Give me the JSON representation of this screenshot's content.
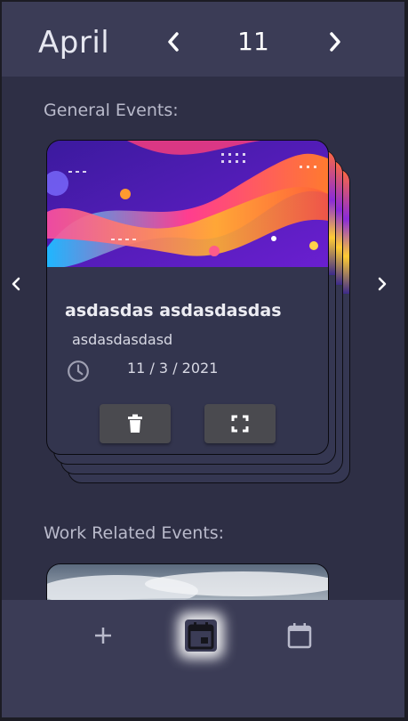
{
  "header": {
    "month": "April",
    "day": "11",
    "prev_icon": "chevron-left-icon",
    "next_icon": "chevron-right-icon"
  },
  "sections": {
    "general_title": "General Events:",
    "work_title": "Work Related Events:"
  },
  "event_card": {
    "title": "asdasdas asdasdasdas",
    "subtitle": "asdasdasdasd",
    "date": "11 / 3 / 2021",
    "delete_icon": "trash-icon",
    "expand_icon": "fullscreen-icon"
  },
  "bottom_nav": {
    "items": [
      "plus-icon",
      "calendar-day-icon",
      "calendar-icon"
    ]
  },
  "colors": {
    "background": "#2e2f45",
    "header": "#3b3c56",
    "card": "#33354e",
    "button": "#4a4a4f"
  }
}
